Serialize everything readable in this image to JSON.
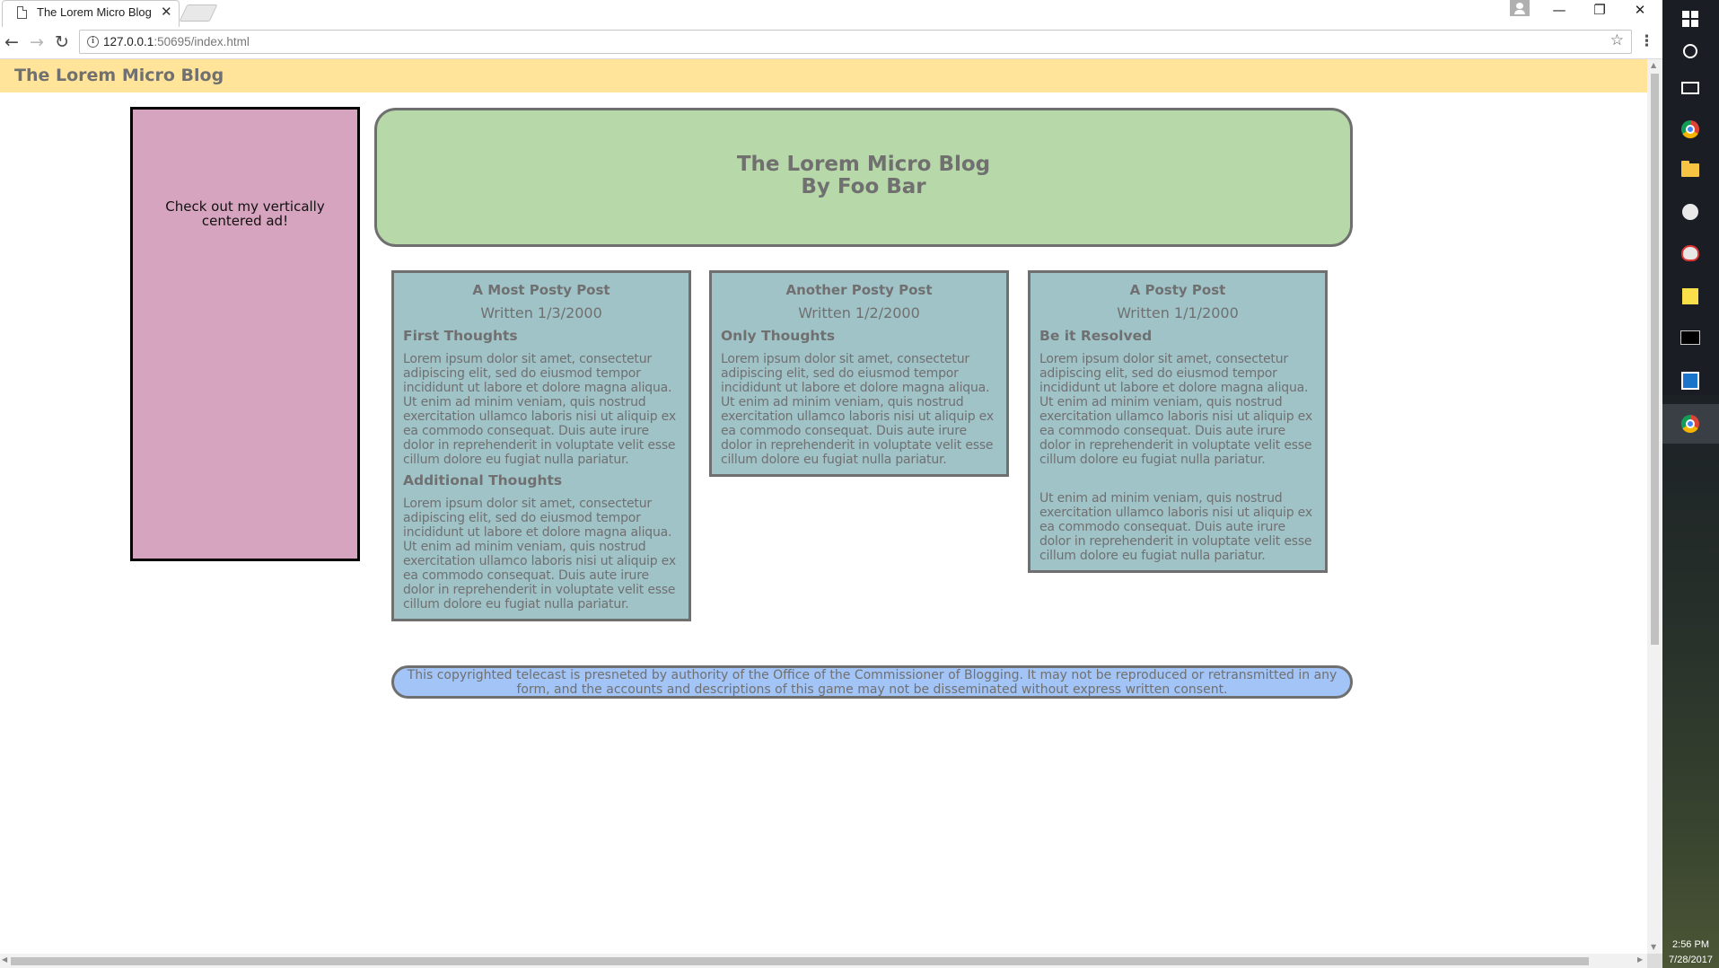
{
  "browser": {
    "tab_title": "The Lorem Micro Blog",
    "tab_close": "✕",
    "url_host": "127.0.0.1",
    "url_rest": ":50695/index.html",
    "nav": {
      "back": "←",
      "forward": "→",
      "reload": "↻"
    },
    "window": {
      "minimize": "—",
      "restore": "❐",
      "close": "✕"
    },
    "star": "☆",
    "menu": "⋮"
  },
  "site": {
    "bar_title": "The Lorem Micro Blog",
    "ad_text": "Check out my vertically centered ad!",
    "header_line1": "The Lorem Micro Blog",
    "header_line2": "By Foo Bar",
    "footer": "This copyrighted telecast is presneted by authority of the Office of the Commissioner of Blogging. It may not be reproduced or retransmitted in any form, and the accounts and descriptions of this game may not be disseminated without express written consent."
  },
  "posts": [
    {
      "title": "A Most Posty Post",
      "date": "Written 1/3/2000",
      "sections": [
        {
          "heading": "First Thoughts",
          "body": "Lorem ipsum dolor sit amet, consectetur adipiscing elit, sed do eiusmod tempor incididunt ut labore et dolore magna aliqua. Ut enim ad minim veniam, quis nostrud exercitation ullamco laboris nisi ut aliquip ex ea commodo consequat. Duis aute irure dolor in reprehenderit in voluptate velit esse cillum dolore eu fugiat nulla pariatur."
        },
        {
          "heading": "Additional Thoughts",
          "body": "Lorem ipsum dolor sit amet, consectetur adipiscing elit, sed do eiusmod tempor incididunt ut labore et dolore magna aliqua. Ut enim ad minim veniam, quis nostrud exercitation ullamco laboris nisi ut aliquip ex ea commodo consequat. Duis aute irure dolor in reprehenderit in voluptate velit esse cillum dolore eu fugiat nulla pariatur."
        }
      ]
    },
    {
      "title": "Another Posty Post",
      "date": "Written 1/2/2000",
      "sections": [
        {
          "heading": "Only Thoughts",
          "body": "Lorem ipsum dolor sit amet, consectetur adipiscing elit, sed do eiusmod tempor incididunt ut labore et dolore magna aliqua. Ut enim ad minim veniam, quis nostrud exercitation ullamco laboris nisi ut aliquip ex ea commodo consequat. Duis aute irure dolor in reprehenderit in voluptate velit esse cillum dolore eu fugiat nulla pariatur."
        }
      ]
    },
    {
      "title": "A Posty Post",
      "date": "Written 1/1/2000",
      "sections": [
        {
          "heading": "Be it Resolved",
          "body": "Lorem ipsum dolor sit amet, consectetur adipiscing elit, sed do eiusmod tempor incididunt ut labore et dolore magna aliqua. Ut enim ad minim veniam, quis nostrud exercitation ullamco laboris nisi ut aliquip ex ea commodo consequat. Duis aute irure dolor in reprehenderit in voluptate velit esse cillum dolore eu fugiat nulla pariatur."
        },
        {
          "heading": "",
          "body": "Ut enim ad minim veniam, quis nostrud exercitation ullamco laboris nisi ut aliquip ex ea commodo consequat. Duis aute irure dolor in reprehenderit in voluptate velit esse cillum dolore eu fugiat nulla pariatur."
        }
      ]
    }
  ],
  "taskbar": {
    "time": "2:56 PM",
    "date": "7/28/2017",
    "icons": [
      "windows-start-icon",
      "cortana-icon",
      "task-view-icon",
      "chrome-icon",
      "file-explorer-icon",
      "emoji-app-icon",
      "paint-icon",
      "sticky-notes-icon",
      "command-prompt-icon",
      "store-icon",
      "chrome-icon"
    ]
  },
  "colors": {
    "site_bar": "#ffe49a",
    "ad_bg": "#d6a4be",
    "header_bg": "#b7d8a8",
    "post_bg": "#a0c3c8",
    "footer_bg": "#a2c4f6",
    "text_gray": "#707070"
  }
}
